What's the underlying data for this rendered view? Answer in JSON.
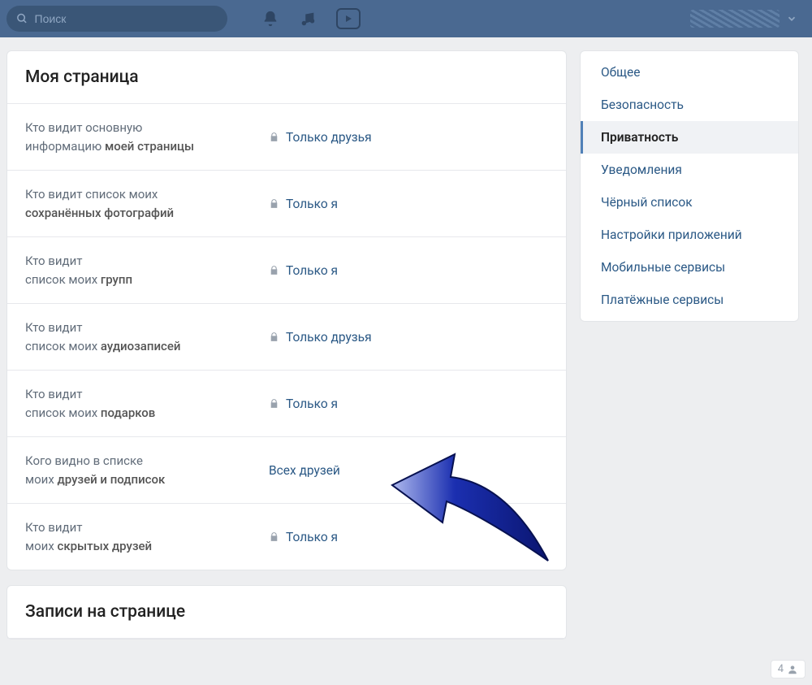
{
  "topbar": {
    "search_placeholder": "Поиск"
  },
  "main": {
    "section1_title": "Моя страница",
    "section2_title": "Записи на странице",
    "rows": [
      {
        "label_pre": "Кто видит основную\nинформацию ",
        "label_bold": "моей страницы",
        "value": "Только друзья",
        "locked": true
      },
      {
        "label_pre": "Кто видит список моих\n",
        "label_bold": "сохранённых фотографий",
        "value": "Только я",
        "locked": true
      },
      {
        "label_pre": "Кто видит\nсписок моих ",
        "label_bold": "групп",
        "value": "Только я",
        "locked": true
      },
      {
        "label_pre": "Кто видит\nсписок моих ",
        "label_bold": "аудиозаписей",
        "value": "Только друзья",
        "locked": true
      },
      {
        "label_pre": "Кто видит\nсписок моих ",
        "label_bold": "подарков",
        "value": "Только я",
        "locked": true
      },
      {
        "label_pre": "Кого видно в списке\nмоих ",
        "label_bold": "друзей и подписок",
        "value": "Всех друзей",
        "locked": false
      },
      {
        "label_pre": "Кто видит\nмоих ",
        "label_bold": "скрытых друзей",
        "value": "Только я",
        "locked": true
      }
    ]
  },
  "sidebar": {
    "items": [
      {
        "label": "Общее",
        "active": false
      },
      {
        "label": "Безопасность",
        "active": false
      },
      {
        "label": "Приватность",
        "active": true
      },
      {
        "label": "Уведомления",
        "active": false
      },
      {
        "label": "Чёрный список",
        "active": false
      },
      {
        "label": "Настройки приложений",
        "active": false
      },
      {
        "label": "Мобильные сервисы",
        "active": false
      },
      {
        "label": "Платёжные сервисы",
        "active": false
      }
    ]
  },
  "footer": {
    "count": "4"
  }
}
